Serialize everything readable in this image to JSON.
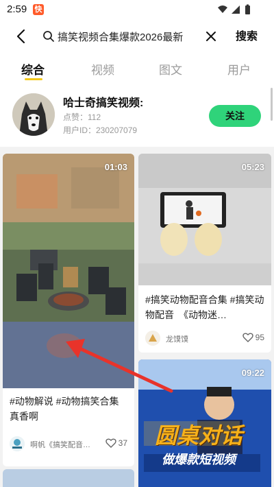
{
  "status_bar": {
    "time": "2:59"
  },
  "search": {
    "query": "搞笑视频合集爆款2026最新",
    "submit_label": "搜索"
  },
  "tabs": [
    {
      "label": "综合"
    },
    {
      "label": "视频"
    },
    {
      "label": "图文"
    },
    {
      "label": "用户"
    }
  ],
  "user_card": {
    "name": "哈士奇搞笑视频:",
    "likes": "点赞：112",
    "user_id": "用户ID：230207079",
    "follow_label": "关注"
  },
  "cards": [
    {
      "duration": "01:03",
      "title": "#动物解说 #动物搞笑合集 真香啊",
      "author": "啊帆《搞笑配音…",
      "likes": "37"
    },
    {
      "duration": "05:23",
      "title": "#搞笑动物配音合集 #搞笑动物配音　《动物迷…",
      "author": "龙馍馍",
      "likes": "95"
    },
    {
      "duration": "09:22",
      "poster_line1": "圆桌对话",
      "poster_line2": "做爆款短视频"
    }
  ],
  "colors": {
    "accent": "#f4c91b",
    "follow": "#2fd37a",
    "annotation_arrow": "#e8332a"
  }
}
